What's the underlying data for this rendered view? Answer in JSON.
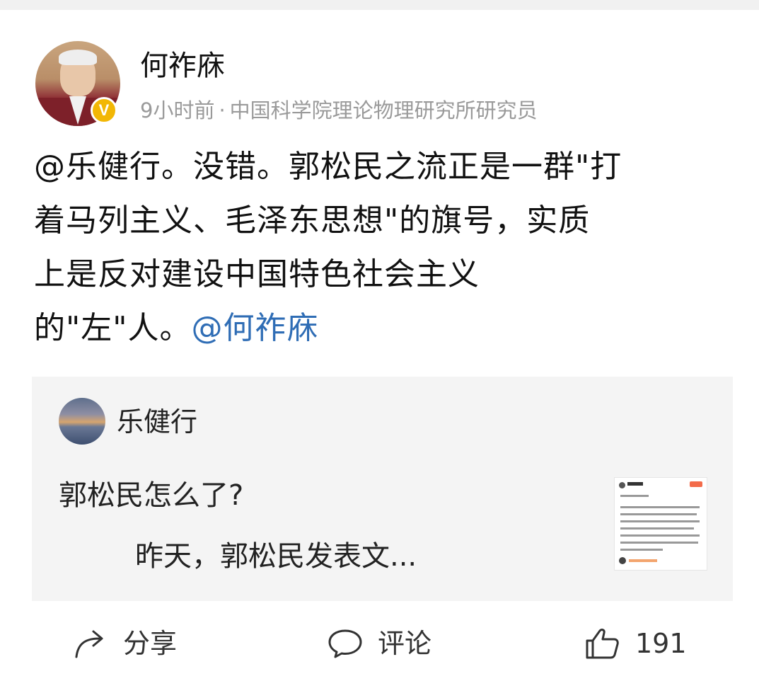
{
  "post": {
    "author": "何祚庥",
    "time": "9小时前",
    "separator": "·",
    "author_title": "中国科学院理论物理研究所研究员",
    "text_lines": [
      "@乐健行。没错。郭松民之流正是一群\"打",
      "着马列主义、毛泽东思想\"的旗号，实质",
      "上是反对建设中国特色社会主义",
      "的\"左\"人。"
    ],
    "mention": "@何祚庥"
  },
  "quote": {
    "author": "乐健行",
    "title": "郭松民怎么了?",
    "snippet": "昨天，郭松民发表文..."
  },
  "actions": {
    "share_label": "分享",
    "comment_label": "评论",
    "like_count": "191"
  },
  "icons": {
    "verified_badge": "V",
    "share": "share-arrow-icon",
    "comment": "comment-bubble-icon",
    "like": "thumbs-up-icon"
  },
  "colors": {
    "mention": "#2f6db5",
    "verified_badge": "#f2b705",
    "meta_text": "#9a9a9a",
    "quote_background": "#f4f4f4"
  }
}
